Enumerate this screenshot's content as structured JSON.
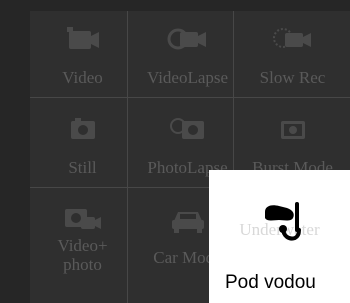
{
  "modes": [
    {
      "id": "video",
      "label": "Video",
      "icon": "video-camera-icon"
    },
    {
      "id": "videolapse",
      "label": "VideoLapse",
      "icon": "videolapse-icon"
    },
    {
      "id": "slowrec",
      "label": "Slow Rec",
      "icon": "slow-rec-icon"
    },
    {
      "id": "still",
      "label": "Still",
      "icon": "still-camera-icon"
    },
    {
      "id": "photolapse",
      "label": "PhotoLapse",
      "icon": "photolapse-icon"
    },
    {
      "id": "burst",
      "label": "Burst Mode",
      "icon": "burst-mode-icon"
    },
    {
      "id": "videophoto",
      "label_line1": "Video+",
      "label_line2": "photo",
      "icon": "video-photo-icon"
    },
    {
      "id": "carmode",
      "label": "Car Mode",
      "icon": "car-icon"
    }
  ],
  "selected": {
    "label": "Pod vodou",
    "ghost_label": "Underwater",
    "icon": "diving-mask-snorkel-icon"
  },
  "colors": {
    "background": "#262626",
    "grid": "#2f2f2f",
    "dim_text": "#5a5a5a",
    "popup": "#ffffff"
  }
}
